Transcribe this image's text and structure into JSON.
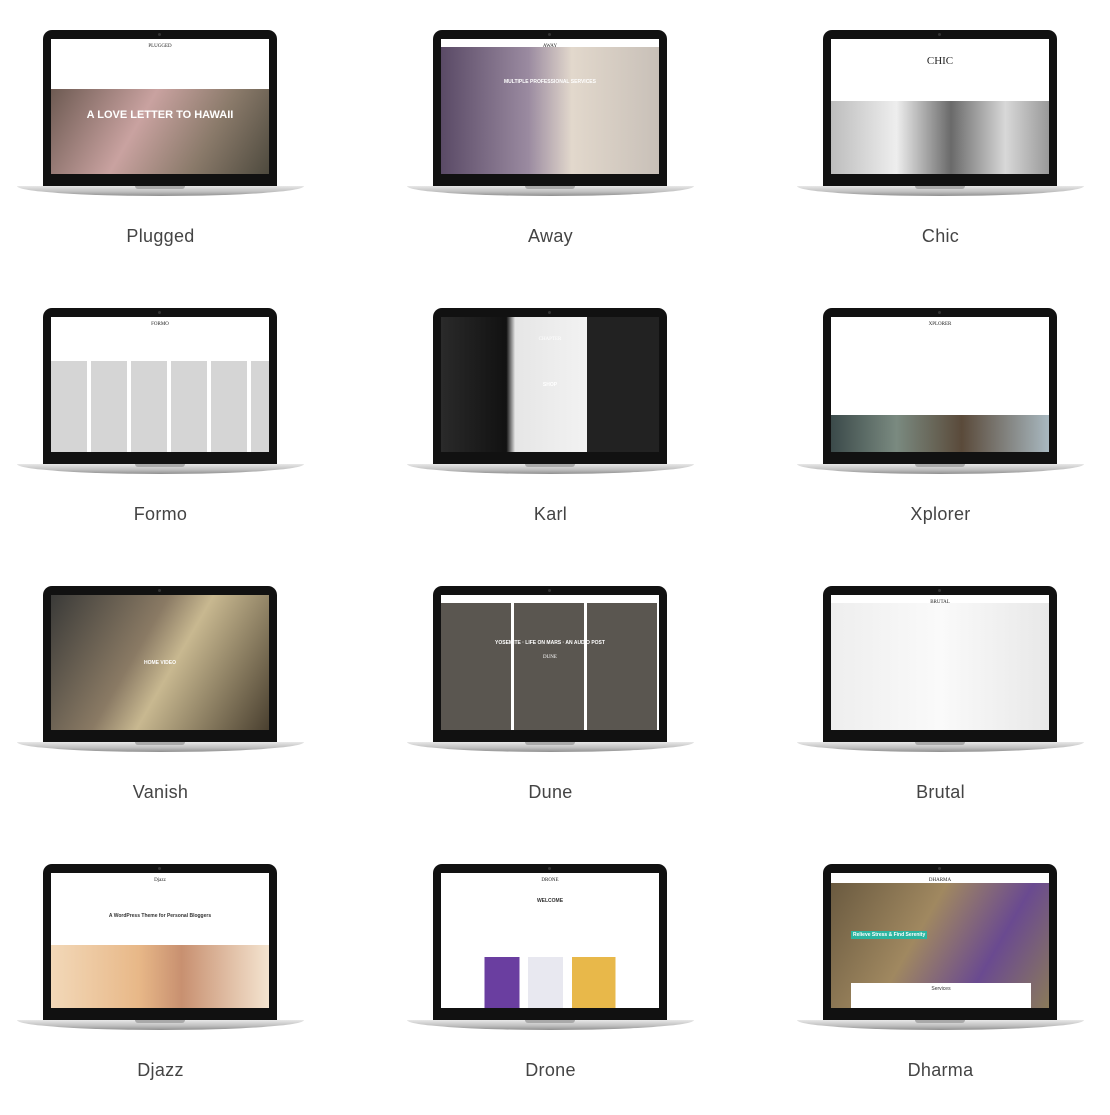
{
  "themes": [
    {
      "name": "Plugged",
      "screen": {
        "title": "PLUGGED",
        "headline": "A LOVE LETTER TO HAWAII"
      }
    },
    {
      "name": "Away",
      "screen": {
        "title": "AWAY",
        "headline": "MULTIPLE PROFESSIONAL SERVICES"
      }
    },
    {
      "name": "Chic",
      "screen": {
        "title": "CHIC",
        "headline": ""
      }
    },
    {
      "name": "Formo",
      "screen": {
        "title": "FORMO",
        "headline": ""
      }
    },
    {
      "name": "Karl",
      "screen": {
        "title": "CHAPTER",
        "headline": "SHOP"
      }
    },
    {
      "name": "Xplorer",
      "screen": {
        "title": "XPLORER",
        "headline": ""
      }
    },
    {
      "name": "Vanish",
      "screen": {
        "title": "",
        "headline": "HOME VIDEO"
      }
    },
    {
      "name": "Dune",
      "screen": {
        "title": "DUNE",
        "headline": "YOSEMITE · LIFE ON MARS · AN AUDIO POST"
      }
    },
    {
      "name": "Brutal",
      "screen": {
        "title": "BRUTAL",
        "headline": ""
      }
    },
    {
      "name": "Djazz",
      "screen": {
        "title": "Djazz",
        "headline": "A WordPress Theme for Personal Bloggers"
      }
    },
    {
      "name": "Drone",
      "screen": {
        "title": "DRONE",
        "headline": "WELCOME"
      }
    },
    {
      "name": "Dharma",
      "screen": {
        "title": "DHARMA",
        "headline": "Relieve Stress & Find Serenity",
        "sub": "Services"
      }
    }
  ]
}
